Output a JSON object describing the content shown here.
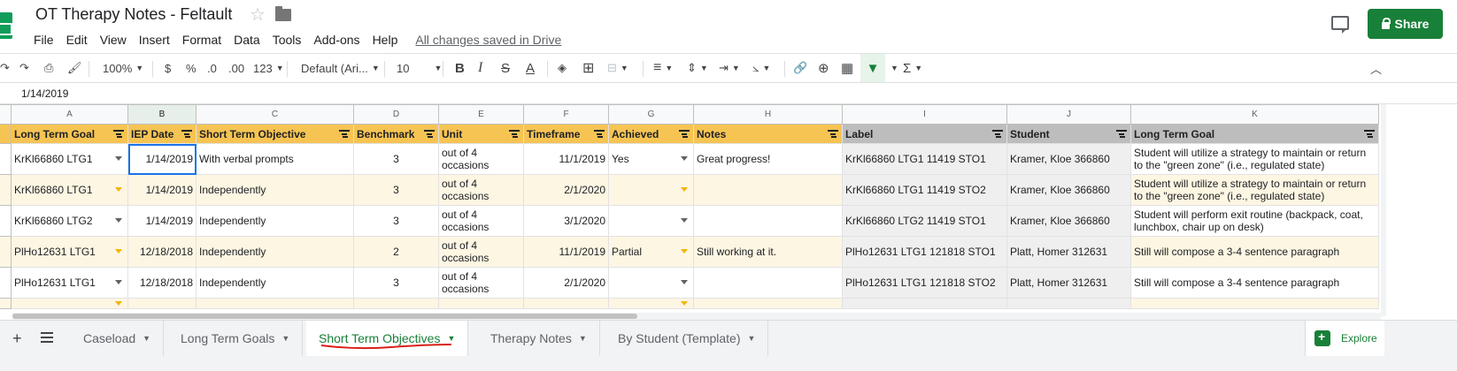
{
  "header": {
    "title": "OT Therapy Notes - Feltault",
    "menus": [
      "File",
      "Edit",
      "View",
      "Insert",
      "Format",
      "Data",
      "Tools",
      "Add-ons",
      "Help"
    ],
    "save_status": "All changes saved in Drive",
    "share_label": "Share"
  },
  "toolbar": {
    "zoom": "100%",
    "currency": "$",
    "percent": "%",
    "dec_less": ".0",
    "dec_more": ".00",
    "more_formats": "123",
    "font": "Default (Ari...",
    "font_size": "10",
    "bold": "B",
    "italic": "I",
    "strike": "S",
    "textcolor": "A"
  },
  "formula_bar": {
    "value": "1/14/2019"
  },
  "grid": {
    "col_letters": [
      "A",
      "B",
      "C",
      "D",
      "E",
      "F",
      "G",
      "H",
      "I",
      "J",
      "K"
    ],
    "headers": [
      "Long Term Goal",
      "IEP Date",
      "Short Term Objective",
      "Benchmark",
      "Unit",
      "Timeframe",
      "Achieved",
      "Notes",
      "Label",
      "Student",
      "Long Term Goal"
    ],
    "rows": [
      [
        "KrKl66860 LTG1",
        "1/14/2019",
        "With verbal prompts",
        "3",
        "out of 4 occasions",
        "11/1/2019",
        "Yes",
        "Great progress!",
        "KrKl66860 LTG1 11419 STO1",
        "Kramer, Kloe 366860",
        "Student will utilize a strategy to maintain or return to the \"green zone\" (i.e., regulated state)"
      ],
      [
        "KrKl66860 LTG1",
        "1/14/2019",
        "Independently",
        "3",
        "out of 4 occasions",
        "2/1/2020",
        "",
        "",
        "KrKl66860 LTG1 11419 STO2",
        "Kramer, Kloe 366860",
        "Student will utilize a strategy to maintain or return to the \"green zone\" (i.e., regulated state)"
      ],
      [
        "KrKl66860 LTG2",
        "1/14/2019",
        "Independently",
        "3",
        "out of 4 occasions",
        "3/1/2020",
        "",
        "",
        "KrKl66860 LTG2 11419 STO1",
        "Kramer, Kloe 366860",
        "Student will perform exit routine (backpack, coat, lunchbox, chair up on desk)"
      ],
      [
        "PlHo12631 LTG1",
        "12/18/2018",
        "Independently",
        "2",
        "out of 4 occasions",
        "11/1/2019",
        "Partial",
        "Still working at it.",
        "PlHo12631 LTG1 121818 STO1",
        "Platt, Homer 312631",
        "Still will compose a 3-4 sentence paragraph"
      ],
      [
        "PlHo12631 LTG1",
        "12/18/2018",
        "Independently",
        "3",
        "out of 4 occasions",
        "2/1/2020",
        "",
        "",
        "PlHo12631 LTG1 121818 STO2",
        "Platt, Homer 312631",
        "Still will compose a 3-4 sentence paragraph"
      ]
    ]
  },
  "sheet_tabs": [
    {
      "label": "Caseload",
      "active": false
    },
    {
      "label": "Long Term Goals",
      "active": false
    },
    {
      "label": "Short Term Objectives",
      "active": true
    },
    {
      "label": "Therapy Notes",
      "active": false
    },
    {
      "label": "By Student (Template)",
      "active": false
    }
  ],
  "explore_label": "Explore",
  "colors": {
    "accent": "#188038",
    "header_fill": "#f6c453",
    "band_fill": "#fdf6e3",
    "selection": "#1a73e8"
  }
}
